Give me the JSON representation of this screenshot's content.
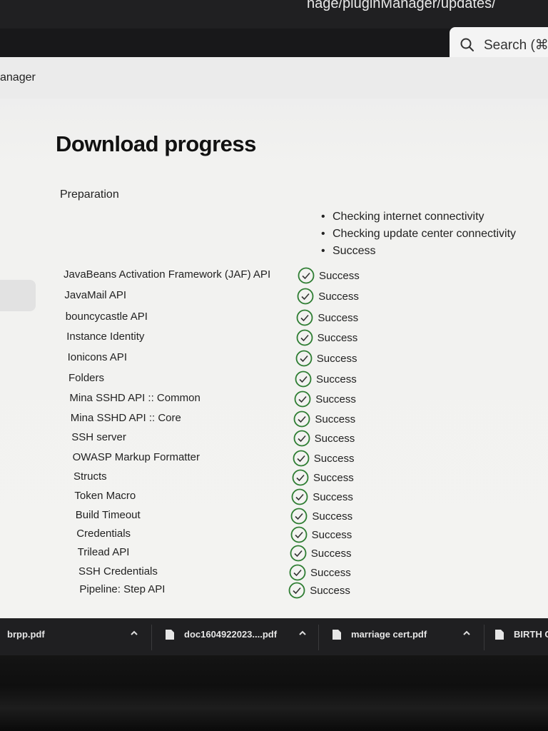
{
  "browser": {
    "url_fragment": "nage/pluginManager/updates/",
    "search_placeholder": "Search (⌘+"
  },
  "breadcrumb": "anager",
  "page": {
    "title": "Download progress",
    "preparation_label": "Preparation",
    "preparation_steps": [
      "Checking internet connectivity",
      "Checking update center connectivity",
      "Success"
    ]
  },
  "plugins": [
    {
      "name": "JavaBeans Activation Framework (JAF) API",
      "status": "Success"
    },
    {
      "name": "JavaMail API",
      "status": "Success"
    },
    {
      "name": "bouncycastle API",
      "status": "Success"
    },
    {
      "name": "Instance Identity",
      "status": "Success"
    },
    {
      "name": "Ionicons API",
      "status": "Success"
    },
    {
      "name": "Folders",
      "status": "Success"
    },
    {
      "name": "Mina SSHD API :: Common",
      "status": "Success"
    },
    {
      "name": "Mina SSHD API :: Core",
      "status": "Success"
    },
    {
      "name": "SSH server",
      "status": "Success"
    },
    {
      "name": "OWASP Markup Formatter",
      "status": "Success"
    },
    {
      "name": "Structs",
      "status": "Success"
    },
    {
      "name": "Token Macro",
      "status": "Success"
    },
    {
      "name": "Build Timeout",
      "status": "Success"
    },
    {
      "name": "Credentials",
      "status": "Success"
    },
    {
      "name": "Trilead API",
      "status": "Success"
    },
    {
      "name": "SSH Credentials",
      "status": "Success"
    },
    {
      "name": "Pipeline: Step API",
      "status": "Success"
    }
  ],
  "downloads": [
    {
      "name": "brpp.pdf"
    },
    {
      "name": "doc1604922023....pdf"
    },
    {
      "name": "marriage cert.pdf"
    },
    {
      "name": "BIRTH C"
    }
  ],
  "colors": {
    "success_green": "#2e7d32",
    "page_bg": "#f2f2f0",
    "download_bar": "#1f1f21"
  }
}
